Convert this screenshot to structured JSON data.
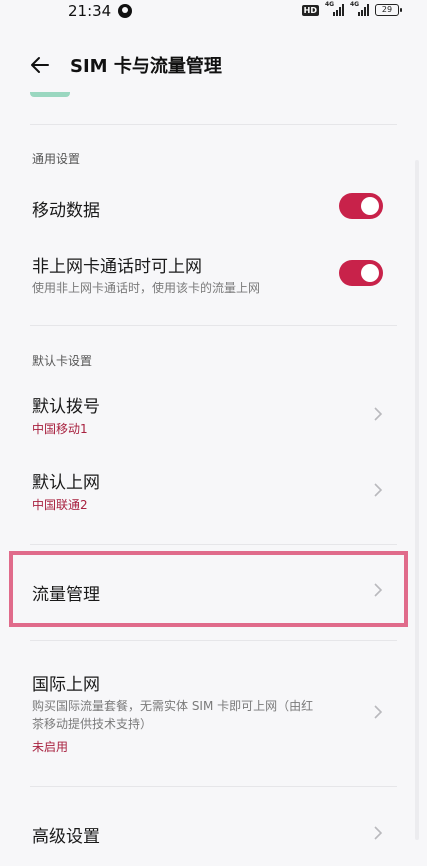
{
  "status_bar": {
    "time": "21:34",
    "hd": "HD",
    "net1": "4G",
    "net2": "4G",
    "battery": "29"
  },
  "header": {
    "title": "SIM 卡与流量管理"
  },
  "general": {
    "section_title": "通用设置",
    "mobile_data_label": "移动数据",
    "mobile_data_on": true,
    "call_data_label": "非上网卡通话时可上网",
    "call_data_desc": "使用非上网卡通话时，使用该卡的流量上网",
    "call_data_on": true
  },
  "default_card": {
    "section_title": "默认卡设置",
    "dial_label": "默认拨号",
    "dial_value": "中国移动1",
    "data_label": "默认上网",
    "data_value": "中国联通2"
  },
  "traffic": {
    "label": "流量管理"
  },
  "international": {
    "label": "国际上网",
    "desc_line1": "购买国际流量套餐，无需实体 SIM 卡即可上网（由红",
    "desc_line2": "茶移动提供技术支持）",
    "status": "未启用"
  },
  "advanced": {
    "label": "高级设置"
  },
  "colors": {
    "accent": "#c8224a",
    "highlight": "#e06b8b",
    "value_text": "#a8213f"
  }
}
